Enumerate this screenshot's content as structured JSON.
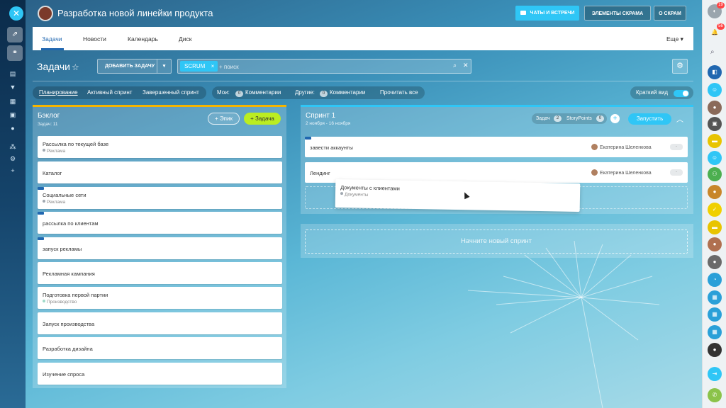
{
  "project": {
    "title": "Разработка новой линейки продукта"
  },
  "header": {
    "chat_label": "Чаты и встречи",
    "scrum_label": "Элементы скрама",
    "about_label": "О скрам"
  },
  "tabs": [
    {
      "label": "Задачи"
    },
    {
      "label": "Новости"
    },
    {
      "label": "Календарь"
    },
    {
      "label": "Диск"
    }
  ],
  "more_label": "Еще ▾",
  "tasks": {
    "title": "Задачи",
    "add_task_label": "Добавить задачу",
    "filter_chip": "SCRUM",
    "search_placeholder": "+ поиск"
  },
  "filter_bar": {
    "views": [
      "Планирование",
      "Активный спринт",
      "Завершенный спринт"
    ],
    "mine_label": "Мои:",
    "mine_count": "0",
    "mine_comments": "Комментарии",
    "others_label": "Другие:",
    "others_count": "0",
    "others_comments": "Комментарии",
    "read_all": "Прочитать все",
    "compact_label": "Краткий вид"
  },
  "backlog": {
    "title": "Бэклог",
    "count_label": "Задач: 11",
    "epic_btn": "+ Эпик",
    "add_btn": "+ Задача",
    "items": [
      {
        "title": "Рассылка по текущей базе",
        "epic": "Реклама"
      },
      {
        "title": "Каталог",
        "epic": ""
      },
      {
        "title": "Социальные сети",
        "epic": "Реклама"
      },
      {
        "title": "рассылка по клиентам",
        "epic": ""
      },
      {
        "title": "запуск рекламы",
        "epic": ""
      },
      {
        "title": "Рекламная кампания",
        "epic": ""
      },
      {
        "title": "Подготовка первой партии",
        "epic": "Производство"
      },
      {
        "title": "Запуск производства",
        "epic": ""
      },
      {
        "title": "Разработка дизайна",
        "epic": ""
      },
      {
        "title": "Изучение спроса",
        "epic": ""
      }
    ]
  },
  "sprint": {
    "title": "Спринт 1",
    "dates": "2 ноября - 16 ноября",
    "tasks_label": "Задач",
    "tasks_count": "2",
    "sp_label": "StoryPoints",
    "sp_count": "0",
    "start_btn": "Запустить",
    "items": [
      {
        "title": "завести аккаунты",
        "assignee": "Екатерина Шеленкова",
        "points": "-"
      },
      {
        "title": "Лендинг",
        "assignee": "Екатерина Шеленкова",
        "points": "-"
      }
    ]
  },
  "dragging": {
    "title": "Документы с клиентами",
    "epic": "Документы"
  },
  "new_sprint_label": "Начните новый спринт",
  "right_rail": {
    "badge_top": "19",
    "badge_bell": "56"
  },
  "colors": {
    "accent": "#2fc6f6",
    "add_green": "#bbed21",
    "backlog_bar": "#f5b500",
    "link_blue": "#2067b0"
  }
}
